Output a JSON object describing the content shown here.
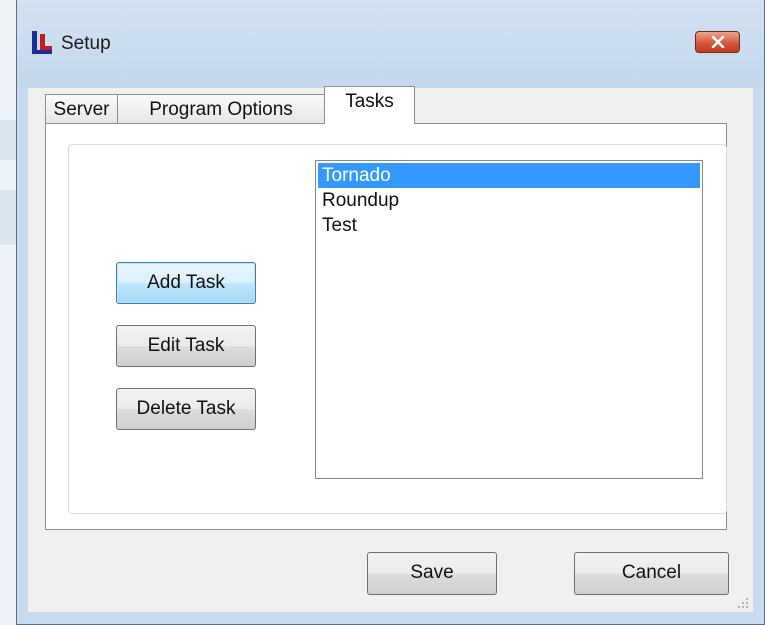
{
  "window": {
    "title": "Setup",
    "app_icon": "app-logo-icon",
    "close_icon": "close-icon"
  },
  "tabs": [
    {
      "label": "Server",
      "active": false
    },
    {
      "label": "Program Options",
      "active": false
    },
    {
      "label": "Tasks",
      "active": true
    }
  ],
  "tasks_panel": {
    "buttons": {
      "add": "Add Task",
      "edit": "Edit Task",
      "delete": "Delete Task"
    },
    "task_list": {
      "items": [
        "Tornado",
        "Roundup",
        "Test"
      ],
      "selected_index": 0
    }
  },
  "footer": {
    "save_label": "Save",
    "cancel_label": "Cancel"
  },
  "colors": {
    "selection": "#3399ff",
    "close_button": "#c2391f",
    "title_bar": "#c9dbee"
  }
}
